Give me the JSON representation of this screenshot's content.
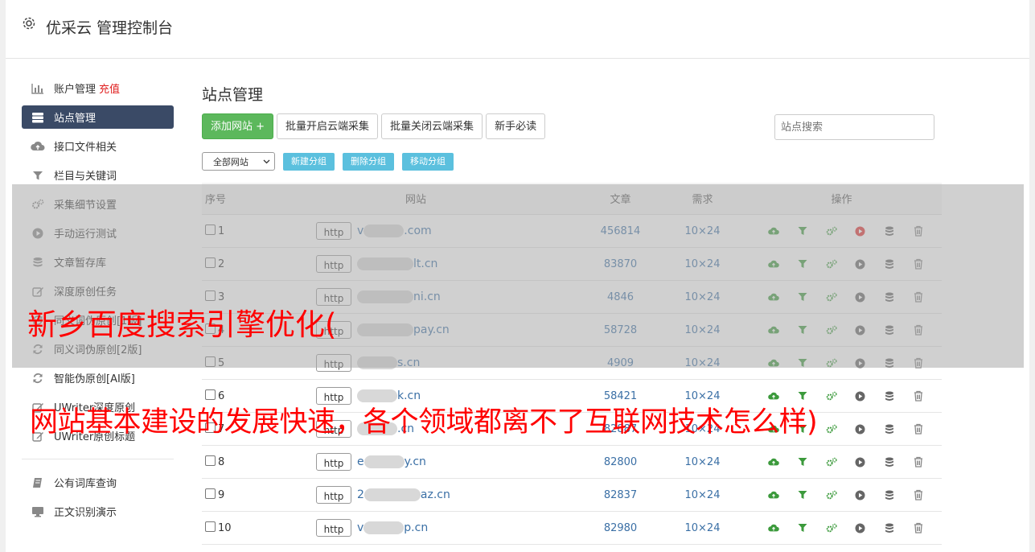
{
  "header": {
    "title": "优采云 管理控制台"
  },
  "sidebar": {
    "items": [
      {
        "label": "账户管理",
        "badge": "充值",
        "icon": "bar-chart-icon"
      },
      {
        "label": "站点管理",
        "icon": "server-icon",
        "active": true
      },
      {
        "label": "接口文件相关",
        "icon": "cloud-upload-icon"
      },
      {
        "label": "栏目与关键词",
        "icon": "filter-icon"
      },
      {
        "label": "采集细节设置",
        "icon": "cogs-icon"
      },
      {
        "label": "手动运行测试",
        "icon": "play-icon"
      },
      {
        "label": "文章暂存库",
        "icon": "database-icon"
      },
      {
        "label": "深度原创任务",
        "icon": "edit-icon"
      },
      {
        "label": "同义词伪原创[1版]",
        "icon": "refresh-icon"
      },
      {
        "label": "同义词伪原创[2版]",
        "icon": "refresh-icon"
      },
      {
        "label": "智能伪原创[AI版]",
        "icon": "refresh-icon"
      },
      {
        "label": "UWriter深度原创",
        "icon": "edit-icon"
      },
      {
        "label": "UWriter原创标题",
        "icon": "edit-icon"
      }
    ],
    "items2": [
      {
        "label": "公有词库查询",
        "icon": "book-icon"
      },
      {
        "label": "正文识别演示",
        "icon": "monitor-icon"
      }
    ]
  },
  "main": {
    "title": "站点管理",
    "toolbar": {
      "add": "添加网站 +",
      "batch_open": "批量开启云端采集",
      "batch_close": "批量关闭云端采集",
      "guide": "新手必读"
    },
    "search_placeholder": "站点搜索",
    "group_select": "全部网站",
    "group_buttons": {
      "new": "新建分组",
      "delete": "删除分组",
      "move": "移动分组"
    },
    "table": {
      "headers": {
        "idx": "序号",
        "site": "网站",
        "articles": "文章",
        "demand": "需求",
        "ops": "操作"
      },
      "http_label": "http",
      "rows": [
        {
          "idx": "1",
          "pre": "v",
          "suf": ".com",
          "articles": "456814",
          "demand": "10×24",
          "play_active": true
        },
        {
          "idx": "2",
          "pre": "",
          "suf": "lt.cn",
          "articles": "83870",
          "demand": "10×24"
        },
        {
          "idx": "3",
          "pre": "",
          "suf": "ni.cn",
          "articles": "4846",
          "demand": "10×24"
        },
        {
          "idx": "4",
          "pre": "",
          "suf": "pay.cn",
          "articles": "58728",
          "demand": "10×24"
        },
        {
          "idx": "5",
          "pre": "",
          "suf": "s.cn",
          "articles": "4909",
          "demand": "10×24"
        },
        {
          "idx": "6",
          "pre": "",
          "suf": "k.cn",
          "articles": "58421",
          "demand": "10×24"
        },
        {
          "idx": "7",
          "pre": "",
          "suf": ".cn",
          "articles": "82887",
          "demand": "10×24"
        },
        {
          "idx": "8",
          "pre": "e",
          "suf": "y.cn",
          "articles": "82800",
          "demand": "10×24"
        },
        {
          "idx": "9",
          "pre": "2",
          "suf": "az.cn",
          "articles": "82837",
          "demand": "10×24"
        },
        {
          "idx": "10",
          "pre": "v",
          "suf": "p.cn",
          "articles": "82980",
          "demand": "10×24"
        }
      ]
    }
  },
  "watermark": {
    "line1": "新乡百度搜索引擎优化(",
    "line2": "网站基本建设的发展快速，各个领域都离不了互联网技术怎么样)"
  },
  "colors": {
    "active_nav": "#3a4a66",
    "green": "#5cb85c",
    "info": "#5bc0de",
    "badge": "#e02020",
    "icon_green": "#3c9a3c",
    "play_red": "#e03030"
  }
}
